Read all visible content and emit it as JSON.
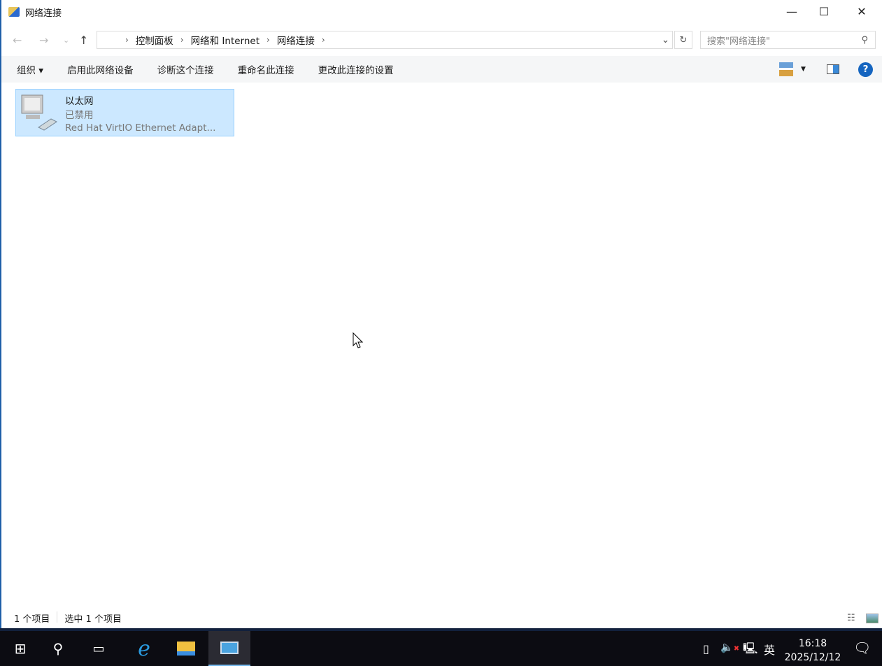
{
  "window": {
    "title": "网络连接"
  },
  "address": {
    "crumbs": [
      "控制面板",
      "网络和 Internet",
      "网络连接"
    ],
    "search_placeholder": "搜索\"网络连接\""
  },
  "commands": {
    "organize": "组织 ▾",
    "enable": "启用此网络设备",
    "diagnose": "诊断这个连接",
    "rename": "重命名此连接",
    "settings": "更改此连接的设置"
  },
  "connection": {
    "name": "以太网",
    "status": "已禁用",
    "device": "Red Hat VirtIO Ethernet Adapt..."
  },
  "statusbar": {
    "count": "1 个项目",
    "selected": "选中 1 个项目"
  },
  "taskbar": {
    "time": "16:18",
    "date": "2025/12/12",
    "ime": "英"
  }
}
